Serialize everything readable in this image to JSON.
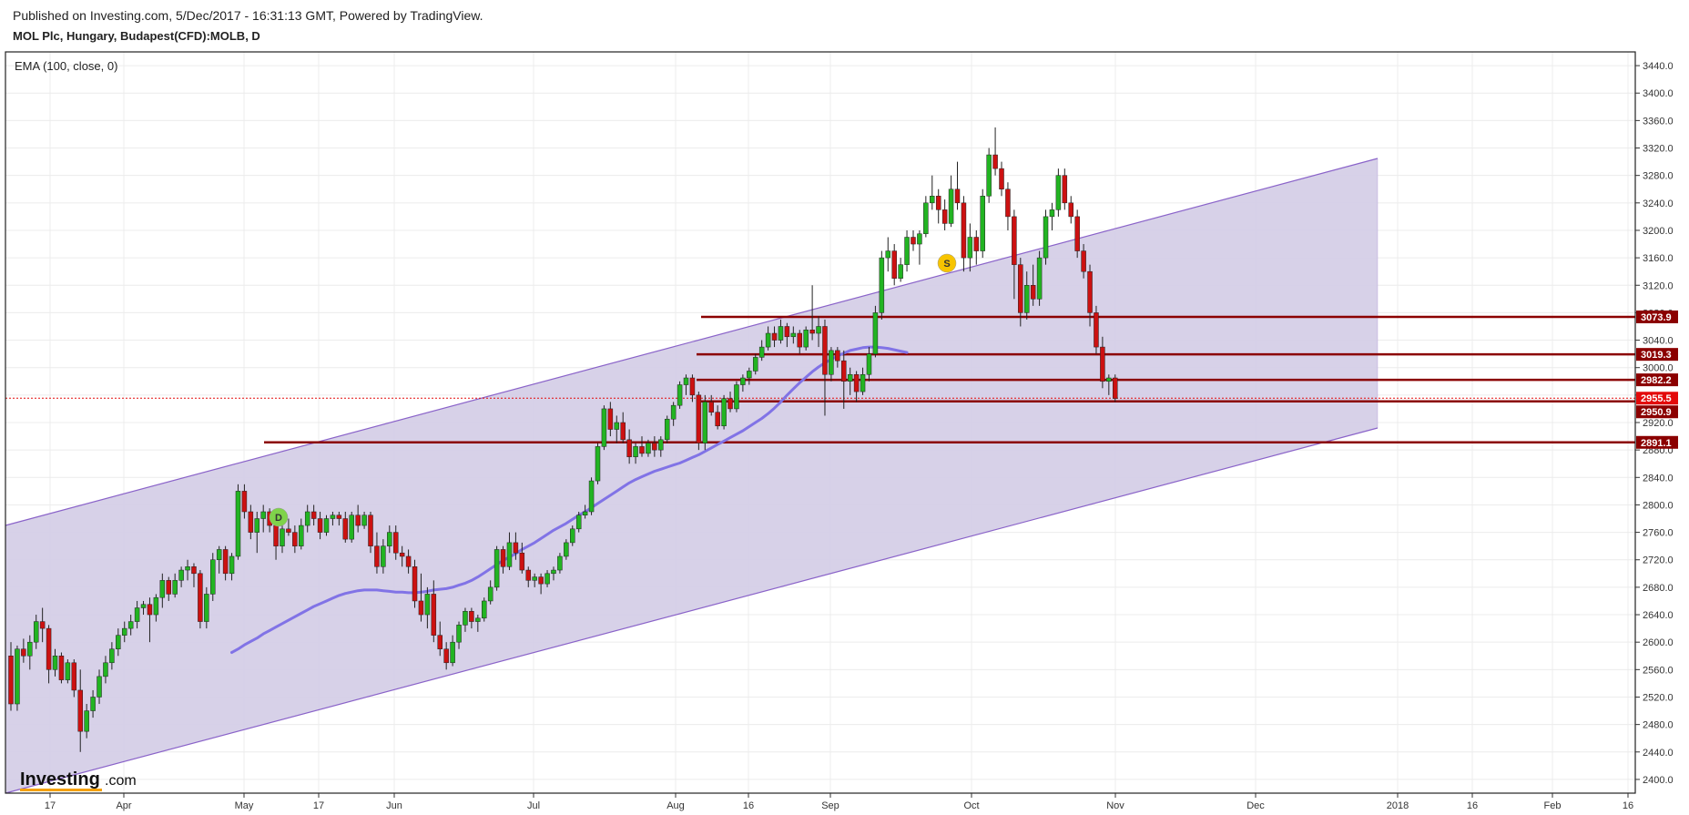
{
  "header": {
    "published": "Published on Investing.com, 5/Dec/2017 - 16:31:13 GMT, Powered by TradingView.",
    "symbol": "MOL Plc, Hungary, Budapest(CFD):MOLB, D"
  },
  "legend": "EMA (100, close, 0)",
  "logo": {
    "word": "Investing",
    "suffix": ".com"
  },
  "colors": {
    "up": "#22b422",
    "down": "#cc1111",
    "channel_fill": "#d5cfe7",
    "channel_line": "#8a63c9",
    "ema": "#8173e6",
    "level": "#8b0000",
    "last": "#e30a0a"
  },
  "chart_data": {
    "type": "candlestick",
    "y_range": [
      2380,
      3460
    ],
    "y_ticks": [
      "2400.0",
      "2440.0",
      "2480.0",
      "2520.0",
      "2560.0",
      "2600.0",
      "2640.0",
      "2680.0",
      "2720.0",
      "2760.0",
      "2800.0",
      "2840.0",
      "2880.0",
      "2920.0",
      "2960.0",
      "3000.0",
      "3040.0",
      "3080.0",
      "3120.0",
      "3160.0",
      "3200.0",
      "3240.0",
      "3280.0",
      "3320.0",
      "3360.0",
      "3400.0",
      "3440.0"
    ],
    "x_ticks": [
      "17",
      "Apr",
      "May",
      "17",
      "Jun",
      "Jul",
      "Aug",
      "16",
      "Sep",
      "Oct",
      "Nov",
      "Dec",
      "2018",
      "16",
      "Feb",
      "16"
    ],
    "levels": [
      {
        "label": "3073.9",
        "value": 3073.9
      },
      {
        "label": "3019.3",
        "value": 3019.3
      },
      {
        "label": "2982.2",
        "value": 2982.2
      },
      {
        "label": "2950.9",
        "value": 2950.9
      },
      {
        "label": "2891.1",
        "value": 2891.1
      }
    ],
    "last_price": {
      "label": "2955.5",
      "value": 2955.5
    },
    "markers": [
      {
        "label": "D"
      },
      {
        "label": "S"
      }
    ],
    "ohlc": [
      [
        2580,
        2600,
        2500,
        2510
      ],
      [
        2510,
        2595,
        2500,
        2590
      ],
      [
        2590,
        2605,
        2570,
        2580
      ],
      [
        2580,
        2610,
        2560,
        2600
      ],
      [
        2600,
        2640,
        2590,
        2630
      ],
      [
        2630,
        2650,
        2600,
        2620
      ],
      [
        2620,
        2625,
        2540,
        2560
      ],
      [
        2560,
        2590,
        2550,
        2580
      ],
      [
        2580,
        2585,
        2540,
        2545
      ],
      [
        2545,
        2575,
        2540,
        2570
      ],
      [
        2570,
        2575,
        2520,
        2530
      ],
      [
        2530,
        2560,
        2440,
        2470
      ],
      [
        2470,
        2510,
        2460,
        2500
      ],
      [
        2500,
        2530,
        2490,
        2520
      ],
      [
        2520,
        2560,
        2510,
        2550
      ],
      [
        2550,
        2580,
        2540,
        2570
      ],
      [
        2570,
        2600,
        2560,
        2590
      ],
      [
        2590,
        2620,
        2580,
        2610
      ],
      [
        2610,
        2630,
        2600,
        2620
      ],
      [
        2620,
        2640,
        2610,
        2630
      ],
      [
        2630,
        2660,
        2620,
        2650
      ],
      [
        2650,
        2660,
        2640,
        2655
      ],
      [
        2655,
        2665,
        2600,
        2640
      ],
      [
        2640,
        2670,
        2630,
        2665
      ],
      [
        2665,
        2700,
        2650,
        2690
      ],
      [
        2690,
        2695,
        2660,
        2670
      ],
      [
        2670,
        2700,
        2665,
        2690
      ],
      [
        2690,
        2710,
        2680,
        2705
      ],
      [
        2705,
        2720,
        2690,
        2710
      ],
      [
        2710,
        2715,
        2680,
        2700
      ],
      [
        2700,
        2705,
        2620,
        2630
      ],
      [
        2630,
        2680,
        2620,
        2670
      ],
      [
        2670,
        2730,
        2660,
        2720
      ],
      [
        2720,
        2740,
        2700,
        2735
      ],
      [
        2735,
        2740,
        2690,
        2700
      ],
      [
        2700,
        2730,
        2690,
        2725
      ],
      [
        2725,
        2830,
        2720,
        2820
      ],
      [
        2820,
        2830,
        2780,
        2790
      ],
      [
        2790,
        2800,
        2750,
        2760
      ],
      [
        2760,
        2790,
        2730,
        2780
      ],
      [
        2780,
        2800,
        2760,
        2790
      ],
      [
        2790,
        2795,
        2760,
        2770
      ],
      [
        2770,
        2780,
        2720,
        2740
      ],
      [
        2740,
        2770,
        2730,
        2765
      ],
      [
        2765,
        2780,
        2755,
        2760
      ],
      [
        2760,
        2770,
        2730,
        2740
      ],
      [
        2740,
        2780,
        2735,
        2770
      ],
      [
        2770,
        2800,
        2760,
        2790
      ],
      [
        2790,
        2800,
        2770,
        2780
      ],
      [
        2780,
        2790,
        2750,
        2760
      ],
      [
        2760,
        2785,
        2755,
        2780
      ],
      [
        2780,
        2790,
        2770,
        2785
      ],
      [
        2785,
        2790,
        2770,
        2780
      ],
      [
        2780,
        2790,
        2745,
        2750
      ],
      [
        2750,
        2790,
        2745,
        2785
      ],
      [
        2785,
        2800,
        2760,
        2770
      ],
      [
        2770,
        2790,
        2765,
        2785
      ],
      [
        2785,
        2790,
        2730,
        2740
      ],
      [
        2740,
        2760,
        2700,
        2710
      ],
      [
        2710,
        2750,
        2700,
        2740
      ],
      [
        2740,
        2770,
        2730,
        2760
      ],
      [
        2760,
        2770,
        2720,
        2730
      ],
      [
        2730,
        2740,
        2710,
        2725
      ],
      [
        2725,
        2735,
        2700,
        2710
      ],
      [
        2710,
        2720,
        2650,
        2660
      ],
      [
        2660,
        2700,
        2630,
        2640
      ],
      [
        2640,
        2680,
        2620,
        2670
      ],
      [
        2670,
        2690,
        2600,
        2610
      ],
      [
        2610,
        2630,
        2580,
        2590
      ],
      [
        2590,
        2600,
        2560,
        2570
      ],
      [
        2570,
        2610,
        2565,
        2600
      ],
      [
        2600,
        2630,
        2590,
        2625
      ],
      [
        2625,
        2650,
        2615,
        2645
      ],
      [
        2645,
        2650,
        2620,
        2630
      ],
      [
        2630,
        2640,
        2615,
        2635
      ],
      [
        2635,
        2665,
        2630,
        2660
      ],
      [
        2660,
        2690,
        2655,
        2680
      ],
      [
        2680,
        2740,
        2675,
        2735
      ],
      [
        2735,
        2740,
        2700,
        2710
      ],
      [
        2710,
        2760,
        2705,
        2745
      ],
      [
        2745,
        2760,
        2720,
        2730
      ],
      [
        2730,
        2745,
        2700,
        2705
      ],
      [
        2705,
        2710,
        2680,
        2690
      ],
      [
        2690,
        2700,
        2680,
        2695
      ],
      [
        2695,
        2700,
        2670,
        2685
      ],
      [
        2685,
        2705,
        2680,
        2700
      ],
      [
        2700,
        2710,
        2690,
        2705
      ],
      [
        2705,
        2730,
        2700,
        2725
      ],
      [
        2725,
        2750,
        2720,
        2745
      ],
      [
        2745,
        2770,
        2740,
        2765
      ],
      [
        2765,
        2790,
        2760,
        2785
      ],
      [
        2785,
        2800,
        2780,
        2790
      ],
      [
        2790,
        2840,
        2785,
        2835
      ],
      [
        2835,
        2890,
        2830,
        2885
      ],
      [
        2885,
        2945,
        2880,
        2940
      ],
      [
        2940,
        2950,
        2900,
        2910
      ],
      [
        2910,
        2930,
        2890,
        2920
      ],
      [
        2920,
        2935,
        2890,
        2895
      ],
      [
        2895,
        2910,
        2860,
        2870
      ],
      [
        2870,
        2890,
        2860,
        2885
      ],
      [
        2885,
        2900,
        2870,
        2875
      ],
      [
        2875,
        2895,
        2870,
        2890
      ],
      [
        2890,
        2900,
        2870,
        2880
      ],
      [
        2880,
        2900,
        2870,
        2895
      ],
      [
        2895,
        2930,
        2890,
        2925
      ],
      [
        2925,
        2950,
        2915,
        2945
      ],
      [
        2945,
        2980,
        2940,
        2975
      ],
      [
        2975,
        2990,
        2960,
        2985
      ],
      [
        2985,
        2990,
        2950,
        2960
      ],
      [
        2960,
        2965,
        2880,
        2890
      ],
      [
        2890,
        2960,
        2880,
        2950
      ],
      [
        2950,
        2960,
        2930,
        2935
      ],
      [
        2935,
        2945,
        2910,
        2915
      ],
      [
        2915,
        2960,
        2910,
        2955
      ],
      [
        2955,
        2965,
        2935,
        2940
      ],
      [
        2940,
        2980,
        2935,
        2975
      ],
      [
        2975,
        2990,
        2965,
        2985
      ],
      [
        2985,
        3000,
        2975,
        2995
      ],
      [
        2995,
        3020,
        2990,
        3015
      ],
      [
        3015,
        3040,
        3010,
        3030
      ],
      [
        3030,
        3060,
        3025,
        3050
      ],
      [
        3050,
        3060,
        3030,
        3040
      ],
      [
        3040,
        3070,
        3035,
        3060
      ],
      [
        3060,
        3065,
        3030,
        3045
      ],
      [
        3045,
        3060,
        3035,
        3050
      ],
      [
        3050,
        3055,
        3020,
        3030
      ],
      [
        3030,
        3060,
        3025,
        3055
      ],
      [
        3055,
        3120,
        3040,
        3050
      ],
      [
        3050,
        3075,
        3030,
        3060
      ],
      [
        3060,
        3070,
        2930,
        2990
      ],
      [
        2990,
        3030,
        2980,
        3025
      ],
      [
        3025,
        3030,
        3000,
        3010
      ],
      [
        3010,
        3025,
        2940,
        2980
      ],
      [
        2980,
        3000,
        2960,
        2990
      ],
      [
        2990,
        2995,
        2950,
        2965
      ],
      [
        2965,
        3000,
        2960,
        2990
      ],
      [
        2990,
        3030,
        2980,
        3020
      ],
      [
        3020,
        3090,
        3015,
        3080
      ],
      [
        3080,
        3170,
        3070,
        3160
      ],
      [
        3160,
        3190,
        3140,
        3170
      ],
      [
        3170,
        3180,
        3120,
        3130
      ],
      [
        3130,
        3160,
        3125,
        3150
      ],
      [
        3150,
        3200,
        3140,
        3190
      ],
      [
        3190,
        3200,
        3170,
        3180
      ],
      [
        3180,
        3200,
        3150,
        3195
      ],
      [
        3195,
        3250,
        3190,
        3240
      ],
      [
        3240,
        3280,
        3230,
        3250
      ],
      [
        3250,
        3260,
        3210,
        3230
      ],
      [
        3230,
        3245,
        3200,
        3210
      ],
      [
        3210,
        3280,
        3205,
        3260
      ],
      [
        3260,
        3300,
        3230,
        3240
      ],
      [
        3240,
        3250,
        3140,
        3160
      ],
      [
        3160,
        3210,
        3140,
        3190
      ],
      [
        3190,
        3200,
        3150,
        3170
      ],
      [
        3170,
        3260,
        3160,
        3250
      ],
      [
        3250,
        3320,
        3240,
        3310
      ],
      [
        3310,
        3350,
        3280,
        3290
      ],
      [
        3290,
        3300,
        3250,
        3260
      ],
      [
        3260,
        3270,
        3200,
        3220
      ],
      [
        3220,
        3230,
        3100,
        3150
      ],
      [
        3150,
        3160,
        3060,
        3080
      ],
      [
        3080,
        3140,
        3070,
        3120
      ],
      [
        3120,
        3150,
        3090,
        3100
      ],
      [
        3100,
        3170,
        3090,
        3160
      ],
      [
        3160,
        3230,
        3150,
        3220
      ],
      [
        3220,
        3240,
        3200,
        3230
      ],
      [
        3230,
        3290,
        3220,
        3280
      ],
      [
        3280,
        3290,
        3230,
        3240
      ],
      [
        3240,
        3250,
        3210,
        3220
      ],
      [
        3220,
        3230,
        3160,
        3170
      ],
      [
        3170,
        3180,
        3130,
        3140
      ],
      [
        3140,
        3150,
        3060,
        3080
      ],
      [
        3080,
        3090,
        3020,
        3030
      ],
      [
        3030,
        3045,
        2970,
        2980
      ],
      [
        2980,
        2990,
        2960,
        2985
      ],
      [
        2985,
        2990,
        2950,
        2955
      ]
    ],
    "ema": [
      2585,
      2590,
      2596,
      2601,
      2606,
      2612,
      2617,
      2622,
      2627,
      2632,
      2637,
      2642,
      2647,
      2652,
      2656,
      2660,
      2664,
      2668,
      2671,
      2673,
      2675,
      2676,
      2676,
      2676,
      2675,
      2674,
      2673,
      2673,
      2672,
      2672,
      2673,
      2674,
      2676,
      2677,
      2678,
      2680,
      2683,
      2686,
      2690,
      2695,
      2701,
      2707,
      2713,
      2719,
      2724,
      2729,
      2735,
      2740,
      2745,
      2751,
      2757,
      2763,
      2768,
      2773,
      2779,
      2785,
      2790,
      2796,
      2802,
      2808,
      2814,
      2820,
      2826,
      2832,
      2837,
      2841,
      2845,
      2849,
      2852,
      2855,
      2858,
      2861,
      2865,
      2869,
      2873,
      2878,
      2883,
      2888,
      2893,
      2898,
      2903,
      2908,
      2914,
      2920,
      2926,
      2933,
      2941,
      2950,
      2960,
      2969,
      2978,
      2986,
      2994,
      3001,
      3007,
      3012,
      3017,
      3021,
      3025,
      3027,
      3029,
      3030,
      3030,
      3029,
      3028,
      3026,
      3024,
      3022
    ]
  }
}
